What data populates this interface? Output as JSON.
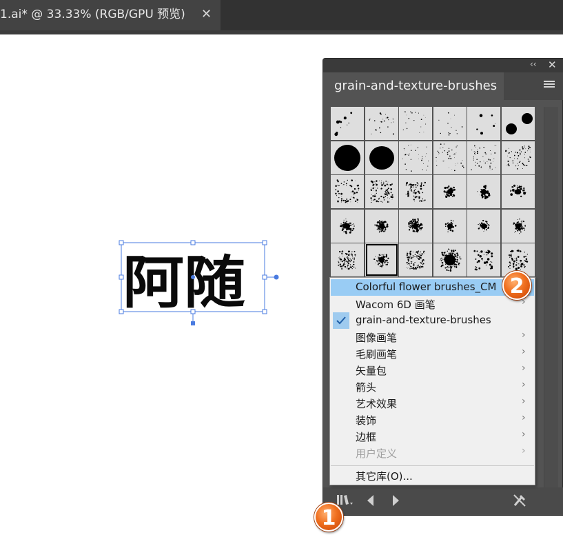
{
  "document_tab": {
    "title": "1.ai* @ 33.33% (RGB/GPU 预览)",
    "close_glyph": "✕"
  },
  "artwork": {
    "text": "阿随"
  },
  "panel": {
    "collapse_glyph": "‹‹",
    "close_glyph": "✕",
    "tab_title": "grain-and-texture-brushes",
    "menu_icon": "hamburger-menu-icon"
  },
  "library_menu": {
    "items": [
      {
        "label": "Colorful flower brushes_CM",
        "submenu": false,
        "highlighted": true,
        "checked": false,
        "disabled": false
      },
      {
        "label": "Wacom 6D 画笔",
        "submenu": true,
        "highlighted": false,
        "checked": false,
        "disabled": false
      },
      {
        "label": "grain-and-texture-brushes",
        "submenu": false,
        "highlighted": false,
        "checked": true,
        "disabled": false
      },
      {
        "label": "图像画笔",
        "submenu": true,
        "highlighted": false,
        "checked": false,
        "disabled": false
      },
      {
        "label": "毛刷画笔",
        "submenu": true,
        "highlighted": false,
        "checked": false,
        "disabled": false
      },
      {
        "label": "矢量包",
        "submenu": true,
        "highlighted": false,
        "checked": false,
        "disabled": false
      },
      {
        "label": "箭头",
        "submenu": true,
        "highlighted": false,
        "checked": false,
        "disabled": false
      },
      {
        "label": "艺术效果",
        "submenu": true,
        "highlighted": false,
        "checked": false,
        "disabled": false
      },
      {
        "label": "装饰",
        "submenu": true,
        "highlighted": false,
        "checked": false,
        "disabled": false
      },
      {
        "label": "边框",
        "submenu": true,
        "highlighted": false,
        "checked": false,
        "disabled": false
      },
      {
        "label": "用户定义",
        "submenu": true,
        "highlighted": false,
        "checked": false,
        "disabled": true
      }
    ],
    "other_library": "其它库(O)...",
    "arrow_glyph": "›",
    "check_glyph": "✓"
  },
  "annotations": {
    "badge_1": "1",
    "badge_2": "2",
    "color": "#f07020"
  },
  "colors": {
    "selection": "#4a7be0",
    "highlight": "#99ccf4"
  }
}
